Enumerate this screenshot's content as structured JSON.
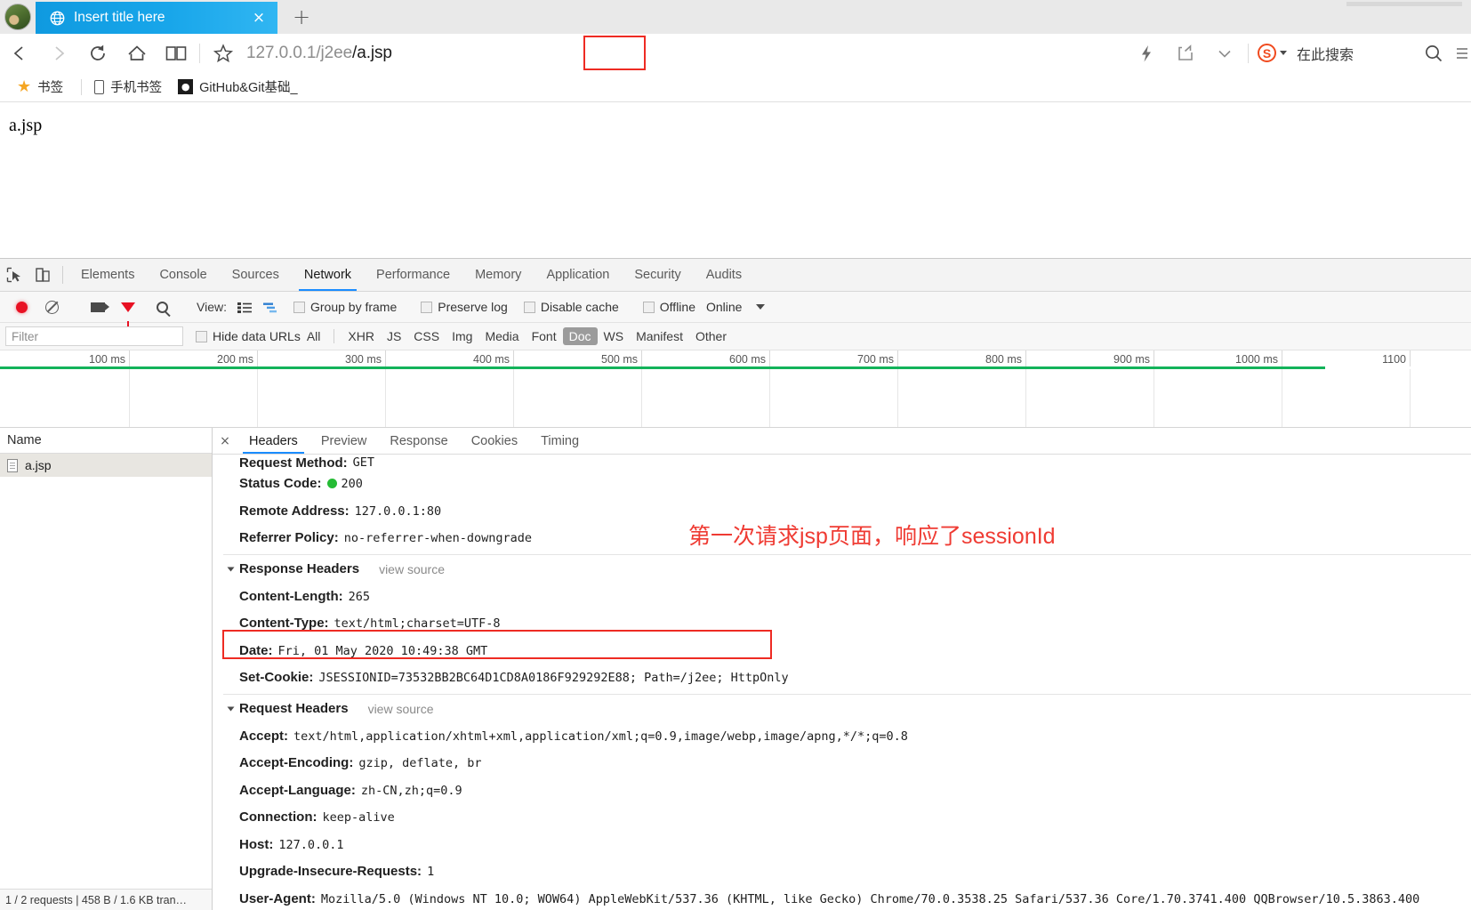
{
  "browser": {
    "tab": {
      "title": "Insert title here",
      "close_label": "×",
      "globe_icon": "globe-icon"
    },
    "new_tab_label": "+",
    "nav": {
      "back_icon": "back-arrow-icon",
      "forward_icon": "forward-arrow-icon",
      "reload_icon": "reload-icon",
      "home_icon": "home-icon",
      "reader_icon": "book-icon",
      "bookmark_star_icon": "star-outline-icon"
    },
    "address": {
      "prefix": "127.0.0.1/j2ee",
      "highlighted": "/a.jsp",
      "full": "127.0.0.1/j2ee/a.jsp"
    },
    "toolbar_right": {
      "lightning_icon": "lightning-icon",
      "share_icon": "share-icon",
      "chevron_icon": "chevron-down-icon",
      "sogou_letter": "S",
      "search_here": "在此搜索",
      "search_icon": "search-icon"
    },
    "bookmarks": [
      {
        "icon": "star-icon",
        "label": "书签"
      },
      {
        "icon": "phone-icon",
        "label": "手机书签"
      },
      {
        "icon": "github-icon",
        "label": "GitHub&Git基础_"
      }
    ]
  },
  "page": {
    "content": "a.jsp"
  },
  "devtools": {
    "panels": [
      "Elements",
      "Console",
      "Sources",
      "Network",
      "Performance",
      "Memory",
      "Application",
      "Security",
      "Audits"
    ],
    "active_panel": "Network",
    "inspect_icon": "inspect-element-icon",
    "device_icon": "device-toolbar-icon",
    "network_controls": {
      "record_icon": "record-icon",
      "clear_icon": "clear-icon",
      "camera_icon": "camera-icon",
      "filter_icon": "filter-funnel-icon",
      "search_icon": "search-icon",
      "view_label": "View:",
      "list_view_icon": "list-view-icon",
      "waterfall_view_icon": "waterfall-view-icon",
      "group_by_frame": "Group by frame",
      "preserve_log": "Preserve log",
      "disable_cache": "Disable cache",
      "offline": "Offline",
      "online": "Online",
      "more_icon": "chevron-down-icon"
    },
    "filter_bar": {
      "filter_placeholder": "Filter",
      "hide_data_urls": "Hide data URLs",
      "types": [
        "All",
        "XHR",
        "JS",
        "CSS",
        "Img",
        "Media",
        "Font",
        "Doc",
        "WS",
        "Manifest",
        "Other"
      ],
      "active_type": "Doc"
    },
    "timeline": {
      "ticks": [
        "100 ms",
        "200 ms",
        "300 ms",
        "400 ms",
        "500 ms",
        "600 ms",
        "700 ms",
        "800 ms",
        "900 ms",
        "1000 ms",
        "1100"
      ]
    },
    "requests": {
      "column_header": "Name",
      "rows": [
        {
          "icon": "document-icon",
          "name": "a.jsp"
        }
      ]
    },
    "detail": {
      "close_label": "×",
      "tabs": [
        "Headers",
        "Preview",
        "Response",
        "Cookies",
        "Timing"
      ],
      "active_tab": "Headers",
      "general": [
        {
          "key": "Request Method:",
          "value": "GET"
        },
        {
          "key": "Status Code:",
          "value": "200",
          "has_dot": true
        },
        {
          "key": "Remote Address:",
          "value": "127.0.0.1:80"
        },
        {
          "key": "Referrer Policy:",
          "value": "no-referrer-when-downgrade"
        }
      ],
      "response_headers_title": "Response Headers",
      "response_view_source": "view source",
      "response_headers": [
        {
          "key": "Content-Length:",
          "value": "265"
        },
        {
          "key": "Content-Type:",
          "value": "text/html;charset=UTF-8"
        },
        {
          "key": "Date:",
          "value": "Fri, 01 May 2020 10:49:38 GMT"
        },
        {
          "key": "Set-Cookie:",
          "value": "JSESSIONID=73532BB2BC64D1CD8A0186F929292E88; Path=/j2ee; HttpOnly"
        }
      ],
      "request_headers_title": "Request Headers",
      "request_view_source": "view source",
      "request_headers": [
        {
          "key": "Accept:",
          "value": "text/html,application/xhtml+xml,application/xml;q=0.9,image/webp,image/apng,*/*;q=0.8"
        },
        {
          "key": "Accept-Encoding:",
          "value": "gzip, deflate, br"
        },
        {
          "key": "Accept-Language:",
          "value": "zh-CN,zh;q=0.9"
        },
        {
          "key": "Connection:",
          "value": "keep-alive"
        },
        {
          "key": "Host:",
          "value": "127.0.0.1"
        },
        {
          "key": "Upgrade-Insecure-Requests:",
          "value": "1"
        },
        {
          "key": "User-Agent:",
          "value": "Mozilla/5.0 (Windows NT 10.0; WOW64) AppleWebKit/537.36 (KHTML, like Gecko) Chrome/70.0.3538.25 Safari/537.36 Core/1.70.3741.400 QQBrowser/10.5.3863.400"
        }
      ]
    },
    "status_bar": "1 / 2 requests  |  458 B / 1.6 KB tran…"
  },
  "annotation": {
    "text": "第一次请求jsp页面，响应了sessionId",
    "color": "#ef3b33"
  },
  "colors": {
    "tab_blue": "#18a6ea",
    "accent_blue": "#1a8cff",
    "highlight_red": "#ee2b23",
    "status_green": "#25bb35",
    "timeline_green": "#13b35a"
  }
}
